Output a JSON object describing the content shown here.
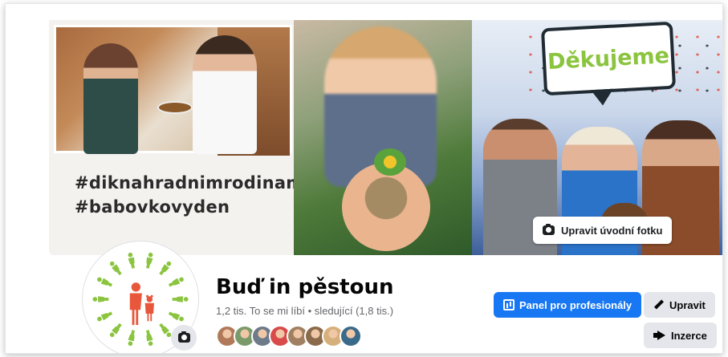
{
  "cover": {
    "hashtag_1": "#diknahradnimrodinam",
    "hashtag_2": "#babovkovyden",
    "bubble_text": "Děkujeme",
    "edit_cover_label": "Upravit úvodní fotku"
  },
  "profile": {
    "name": "Buď in pěstoun",
    "stats": "1,2 tis. To se mi líbí • sledující (1,8 tis.)",
    "follower_faces": [
      "#b07a5a",
      "#7a9a6a",
      "#6c7a8a",
      "#d94a4a",
      "#a08060",
      "#8a6a4a",
      "#d6b07a",
      "#3a6a8a"
    ]
  },
  "actions": {
    "pro_panel_label": "Panel pro profesionály",
    "edit_label": "Upravit",
    "ads_label": "Inzerce"
  },
  "colors": {
    "accent": "#1877f2",
    "logo_green": "#8bc43f",
    "logo_orange": "#e8573b"
  }
}
